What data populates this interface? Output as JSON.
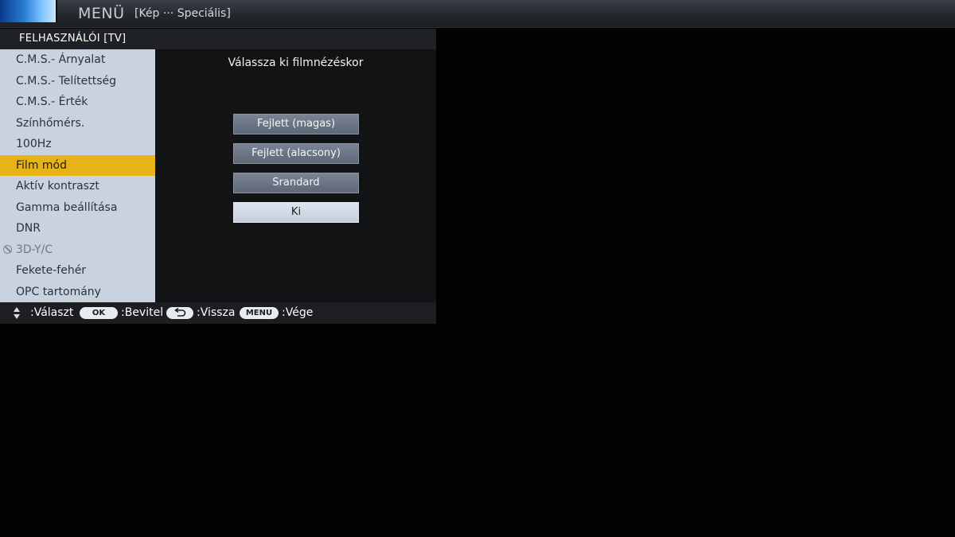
{
  "header": {
    "menu_title": "MENÜ",
    "breadcrumb": "[Kép ··· Speciális]"
  },
  "panel": {
    "title": "FELHASZNÁLÓI [TV]",
    "prompt": "Válassza ki filmnézéskor"
  },
  "menu_items": [
    {
      "label": "C.M.S.- Árnyalat"
    },
    {
      "label": "C.M.S.- Telítettség"
    },
    {
      "label": "C.M.S.- Érték"
    },
    {
      "label": "Színhőmérs."
    },
    {
      "label": "100Hz"
    },
    {
      "label": "Film mód"
    },
    {
      "label": "Aktív kontraszt"
    },
    {
      "label": "Gamma beállítása"
    },
    {
      "label": "DNR"
    },
    {
      "label": "3D-Y/C"
    },
    {
      "label": "Fekete-fehér"
    },
    {
      "label": "OPC tartomány"
    }
  ],
  "selected_item": "Film mód",
  "disabled_item": "3D-Y/C",
  "options": [
    {
      "label": "Fejlett (magas)"
    },
    {
      "label": "Fejlett (alacsony)"
    },
    {
      "label": "Srandard"
    },
    {
      "label": "Ki"
    }
  ],
  "active_option": "Ki",
  "footer": {
    "select_label": ":Választ",
    "ok_key": "OK",
    "enter_label": ":Bevitel",
    "back_label": ":Vissza",
    "menu_key": "MENU",
    "exit_label": ":Vége"
  },
  "icons": {
    "updown": "up-down-arrows-icon",
    "back": "return-arrow-icon",
    "disabled": "prohibited-icon"
  },
  "colors": {
    "selected_bg": "#e8b316",
    "list_bg": "#c9d3df",
    "option_bg": "#6c7585",
    "active_option_bg": "#d3dbe5"
  }
}
